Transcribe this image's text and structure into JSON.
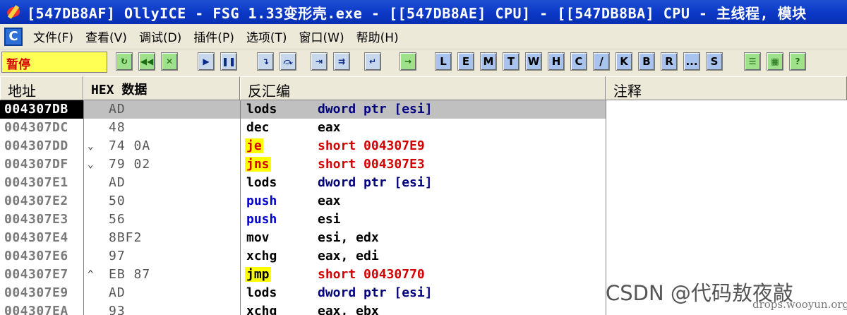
{
  "window": {
    "title": "[547DB8AF] OllyICE - FSG 1.33变形壳.exe - [[547DB8AE] CPU] - [[547DB8BA] CPU - 主线程, 模块"
  },
  "menu": {
    "items": [
      "文件(F)",
      "查看(V)",
      "调试(D)",
      "插件(P)",
      "选项(T)",
      "窗口(W)",
      "帮助(H)"
    ]
  },
  "toolbar": {
    "status": "暂停",
    "letter_buttons": [
      "L",
      "E",
      "M",
      "T",
      "W",
      "H",
      "C",
      "/",
      "K",
      "B",
      "R",
      "...",
      "S"
    ]
  },
  "columns": {
    "address": "地址",
    "hex": "HEX 数据",
    "disasm": "反汇编",
    "comment": "注释"
  },
  "rows": [
    {
      "addr": "004307DB",
      "mark": "",
      "hex": "AD",
      "mnem": "lods",
      "oper": "dword ptr [esi]",
      "mnem_color": "#000000",
      "oper_color": "#000080",
      "hl": false
    },
    {
      "addr": "004307DC",
      "mark": "",
      "hex": "48",
      "mnem": "dec",
      "oper": "eax",
      "mnem_color": "#000000",
      "oper_color": "#000000",
      "hl": false
    },
    {
      "addr": "004307DD",
      "mark": "⌄",
      "hex": "74 0A",
      "mnem": "je",
      "oper": "short 004307E9",
      "mnem_color": "#d40000",
      "oper_color": "#d40000",
      "hl": true
    },
    {
      "addr": "004307DF",
      "mark": "⌄",
      "hex": "79 02",
      "mnem": "jns",
      "oper": "short 004307E3",
      "mnem_color": "#d40000",
      "oper_color": "#d40000",
      "hl": true
    },
    {
      "addr": "004307E1",
      "mark": "",
      "hex": "AD",
      "mnem": "lods",
      "oper": "dword ptr [esi]",
      "mnem_color": "#000000",
      "oper_color": "#000080",
      "hl": false
    },
    {
      "addr": "004307E2",
      "mark": "",
      "hex": "50",
      "mnem": "push",
      "oper": "eax",
      "mnem_color": "#0000d0",
      "oper_color": "#000000",
      "hl": false
    },
    {
      "addr": "004307E3",
      "mark": "",
      "hex": "56",
      "mnem": "push",
      "oper": "esi",
      "mnem_color": "#0000d0",
      "oper_color": "#000000",
      "hl": false
    },
    {
      "addr": "004307E4",
      "mark": "",
      "hex": "8BF2",
      "mnem": "mov",
      "oper": "esi, edx",
      "mnem_color": "#000000",
      "oper_color": "#000000",
      "hl": false
    },
    {
      "addr": "004307E6",
      "mark": "",
      "hex": "97",
      "mnem": "xchg",
      "oper": "eax, edi",
      "mnem_color": "#000000",
      "oper_color": "#000000",
      "hl": false
    },
    {
      "addr": "004307E7",
      "mark": "^",
      "hex": "EB 87",
      "mnem": "jmp",
      "oper": "short 00430770",
      "mnem_color": "#000000",
      "oper_color": "#d40000",
      "hl": true
    },
    {
      "addr": "004307E9",
      "mark": "",
      "hex": "AD",
      "mnem": "lods",
      "oper": "dword ptr [esi]",
      "mnem_color": "#000000",
      "oper_color": "#000080",
      "hl": false
    },
    {
      "addr": "004307EA",
      "mark": "",
      "hex": "93",
      "mnem": "xchg",
      "oper": "eax, ebx",
      "mnem_color": "#000000",
      "oper_color": "#000000",
      "hl": false
    }
  ],
  "watermark": "CSDN @代码敖夜敲",
  "watermark2": "drops.wooyun.org"
}
